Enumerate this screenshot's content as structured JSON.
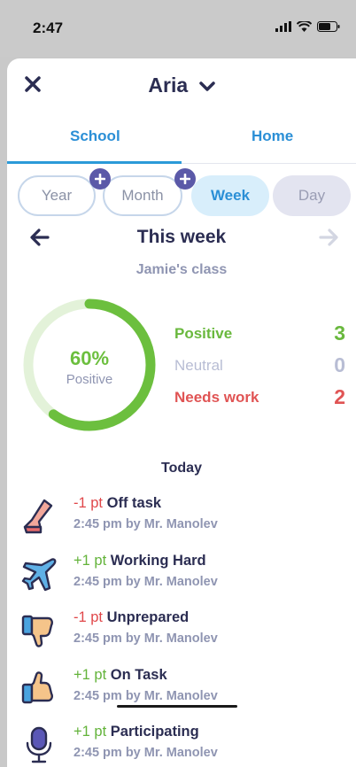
{
  "status": {
    "time": "2:47"
  },
  "header": {
    "student_name": "Aria"
  },
  "tabs": [
    {
      "label": "School"
    },
    {
      "label": "Home"
    }
  ],
  "ranges": [
    {
      "label": "Year"
    },
    {
      "label": "Month"
    },
    {
      "label": "Week"
    },
    {
      "label": "Day"
    }
  ],
  "period": {
    "title": "This week",
    "class_name": "Jamie's class"
  },
  "summary": {
    "percent_label": "60%",
    "percent_caption": "Positive",
    "positive_fraction": 0.6,
    "legend": [
      {
        "label": "Positive",
        "count": "3",
        "color": "#69b83d"
      },
      {
        "label": "Neutral",
        "count": "0",
        "color": "#b8bdd4"
      },
      {
        "label": "Needs work",
        "count": "2",
        "color": "#e05454"
      }
    ]
  },
  "feed": {
    "section_title": "Today",
    "items": [
      {
        "points": "-1 pt",
        "title": "Off task",
        "meta": "2:45 pm by Mr. Manolev",
        "icon": "leg-icon"
      },
      {
        "points": "+1 pt",
        "title": "Working Hard",
        "meta": "2:45 pm by Mr. Manolev",
        "icon": "airplane-icon"
      },
      {
        "points": "-1 pt",
        "title": "Unprepared",
        "meta": "2:45 pm by Mr. Manolev",
        "icon": "thumbs-down-icon"
      },
      {
        "points": "+1 pt",
        "title": "On Task",
        "meta": "2:45 pm by Mr. Manolev",
        "icon": "thumbs-up-icon"
      },
      {
        "points": "+1 pt",
        "title": "Participating",
        "meta": "2:45 pm by Mr. Manolev",
        "icon": "microphone-icon"
      }
    ]
  },
  "colors": {
    "accent": "#2b8fd6",
    "positive": "#69b83d",
    "negative": "#e05454",
    "plus_badge": "#5b59a8"
  }
}
